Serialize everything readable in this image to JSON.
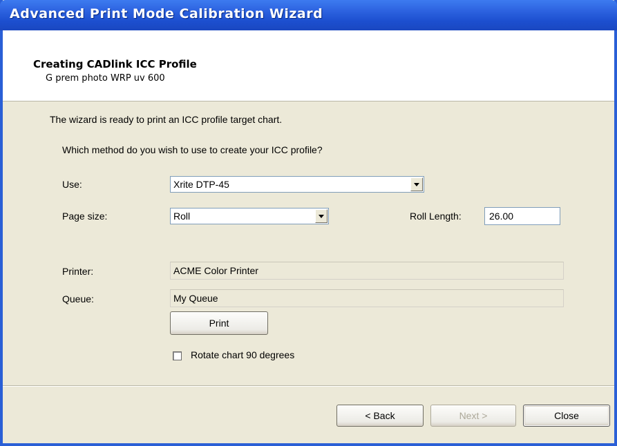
{
  "window": {
    "title": "Advanced Print Mode Calibration Wizard"
  },
  "header": {
    "title": "Creating CADlink ICC Profile",
    "subtitle": "G prem photo WRP uv 600"
  },
  "body": {
    "intro": "The wizard is ready to print an ICC profile target chart.",
    "question": "Which method do you wish to use to create your ICC profile?",
    "use": {
      "label": "Use:",
      "value": "Xrite DTP-45"
    },
    "page_size": {
      "label": "Page size:",
      "value": "Roll"
    },
    "roll_length": {
      "label": "Roll Length:",
      "value": "26.00"
    },
    "printer": {
      "label": "Printer:",
      "value": "ACME Color Printer"
    },
    "queue": {
      "label": "Queue:",
      "value": "My Queue"
    },
    "print_button": "Print",
    "rotate_checkbox": {
      "label": "Rotate chart 90 degrees",
      "checked": false
    }
  },
  "footer": {
    "back": "< Back",
    "next": "Next >",
    "close": "Close"
  }
}
